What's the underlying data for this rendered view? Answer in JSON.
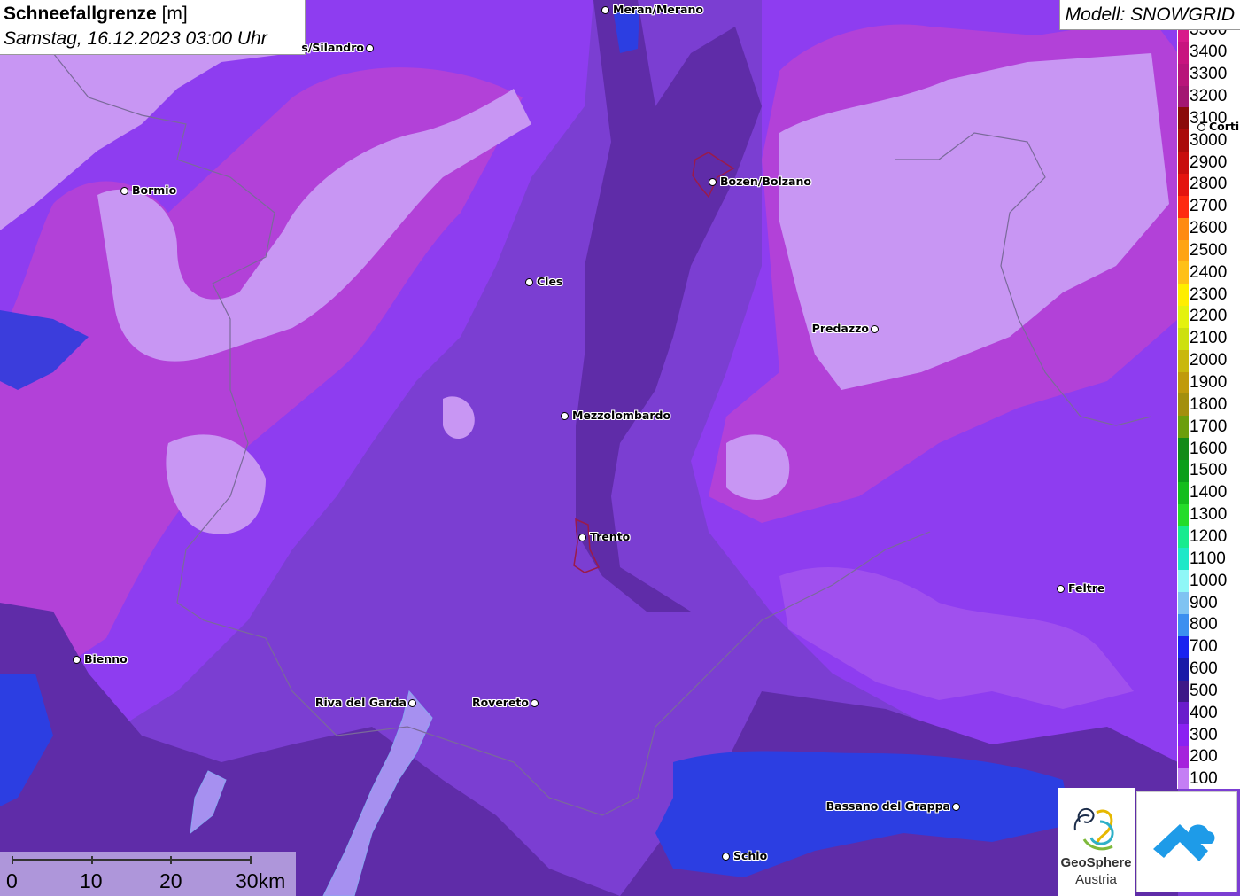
{
  "header": {
    "title": "Schneefallgrenze",
    "unit": "[m]",
    "datetime": "Samstag, 16.12.2023 03:00 Uhr"
  },
  "model": {
    "label": "Modell: SNOWGRID"
  },
  "legend": [
    {
      "value": "3500",
      "color": "#d81b8a"
    },
    {
      "value": "3400",
      "color": "#c8157f"
    },
    {
      "value": "3300",
      "color": "#b8157a"
    },
    {
      "value": "3200",
      "color": "#a31672"
    },
    {
      "value": "3100",
      "color": "#8b0a0a"
    },
    {
      "value": "3000",
      "color": "#aa0a0a"
    },
    {
      "value": "2900",
      "color": "#c80d0d"
    },
    {
      "value": "2800",
      "color": "#e4140f"
    },
    {
      "value": "2700",
      "color": "#ff2a10"
    },
    {
      "value": "2600",
      "color": "#ff8a12"
    },
    {
      "value": "2500",
      "color": "#ffa413"
    },
    {
      "value": "2400",
      "color": "#ffc017"
    },
    {
      "value": "2300",
      "color": "#ffee00"
    },
    {
      "value": "2200",
      "color": "#e4f20e"
    },
    {
      "value": "2100",
      "color": "#cde00f"
    },
    {
      "value": "2000",
      "color": "#c9b80c"
    },
    {
      "value": "1900",
      "color": "#c09a0b"
    },
    {
      "value": "1800",
      "color": "#a38f0d"
    },
    {
      "value": "1700",
      "color": "#6c9e0c"
    },
    {
      "value": "1600",
      "color": "#138a18"
    },
    {
      "value": "1500",
      "color": "#0a9e1a"
    },
    {
      "value": "1400",
      "color": "#13bd1d"
    },
    {
      "value": "1300",
      "color": "#24dc2a"
    },
    {
      "value": "1200",
      "color": "#17eb8f"
    },
    {
      "value": "1100",
      "color": "#1ee8c8"
    },
    {
      "value": "1000",
      "color": "#8ff7f7"
    },
    {
      "value": "900",
      "color": "#7fc3f2"
    },
    {
      "value": "800",
      "color": "#3c8ff0"
    },
    {
      "value": "700",
      "color": "#1a22f0"
    },
    {
      "value": "600",
      "color": "#1a1aa8"
    },
    {
      "value": "500",
      "color": "#3e1888"
    },
    {
      "value": "400",
      "color": "#6a1ccc"
    },
    {
      "value": "300",
      "color": "#8a20f2"
    },
    {
      "value": "200",
      "color": "#a522dc"
    },
    {
      "value": "100",
      "color": "#c47ef4"
    }
  ],
  "cities": [
    {
      "name": "Meran/Merano",
      "side": "right"
    },
    {
      "name": "s/Silandro",
      "side": "left"
    },
    {
      "name": "Bozen/Bolzano",
      "side": "right"
    },
    {
      "name": "Bormio",
      "side": "right"
    },
    {
      "name": "Cles",
      "side": "right"
    },
    {
      "name": "Predazzo",
      "side": "left"
    },
    {
      "name": "Mezzolombardo",
      "side": "right"
    },
    {
      "name": "Trento",
      "side": "right"
    },
    {
      "name": "Feltre",
      "side": "right"
    },
    {
      "name": "Bienno",
      "side": "right"
    },
    {
      "name": "Riva del Garda",
      "side": "left"
    },
    {
      "name": "Rovereto",
      "side": "left"
    },
    {
      "name": "Bassano del Grappa",
      "side": "left"
    },
    {
      "name": "Schio",
      "side": "right"
    },
    {
      "name": "Corti",
      "side": "right"
    }
  ],
  "scale_bar": {
    "labels": [
      "0",
      "10",
      "20",
      "30km"
    ]
  },
  "logos": {
    "geosphere_line1": "GeoSphere",
    "geosphere_line2": "Austria"
  },
  "colors": {
    "bg": "#7a3fd0",
    "light": "#c590f2",
    "medium": "#9b45f0",
    "dark": "#5a2ba8",
    "deep_blue": "#2a3ee0",
    "pink": "#b63ad2"
  }
}
